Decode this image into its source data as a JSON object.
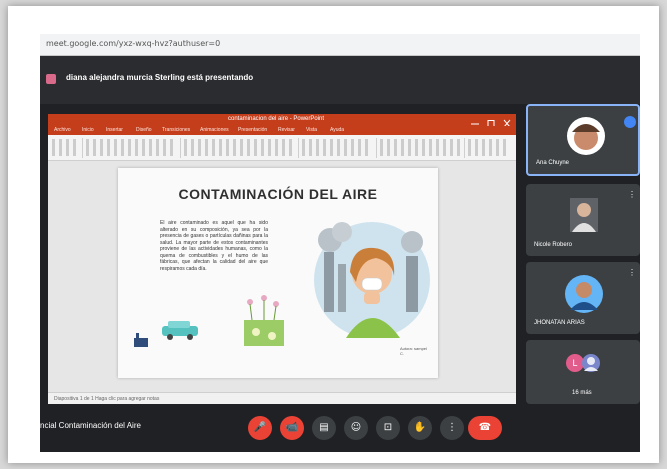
{
  "browser": {
    "url": "meet.google.com/yxz-wxq-hvz?authuser=0"
  },
  "banner": {
    "presenting_text": "diana alejandra murcia Sterling está presentando"
  },
  "powerpoint": {
    "window_title": "contaminacion del aire - PowerPoint",
    "tabs": [
      "Archivo",
      "Inicio",
      "Insertar",
      "Diseño",
      "Transiciones",
      "Animaciones",
      "Presentación",
      "Revisar",
      "Vista",
      "Ayuda"
    ],
    "status": "Diapositiva 1 de 1   Haga clic para agregar notas"
  },
  "slide": {
    "title": "CONTAMINACIÓN DEL AIRE",
    "body": "El aire contaminado es aquel que ha sido alterado en su composición, ya sea por la presencia de gases o partículas dañinas para la salud. La mayor parte de estos contaminantes proviene de las actividades humanas, como la quema de combustibles y el humo de las fábricas, que afectan la calidad del aire que respiramos cada día.",
    "caption": "Autora: sampel C."
  },
  "participants": [
    {
      "name": "Ana Chuyne",
      "initial": "",
      "color": "#8ab4f8"
    },
    {
      "name": "Nicole Robero",
      "initial": "",
      "color": "#9e9e9e"
    },
    {
      "name": "JHONATAN ARIAS",
      "initial": "",
      "color": "#64b5f6"
    },
    {
      "name": "16 más",
      "initial": "L",
      "color": "#e25c8b"
    }
  ],
  "controls": {
    "meeting_title": "ncial Contaminación del Aire",
    "mic_icon": "🎤",
    "cam_icon": "📹",
    "cc_icon": "▤",
    "present_icon": "⊡",
    "raise_hand_icon": "✋",
    "more_icon": "⋮",
    "hangup_icon": "☎"
  }
}
